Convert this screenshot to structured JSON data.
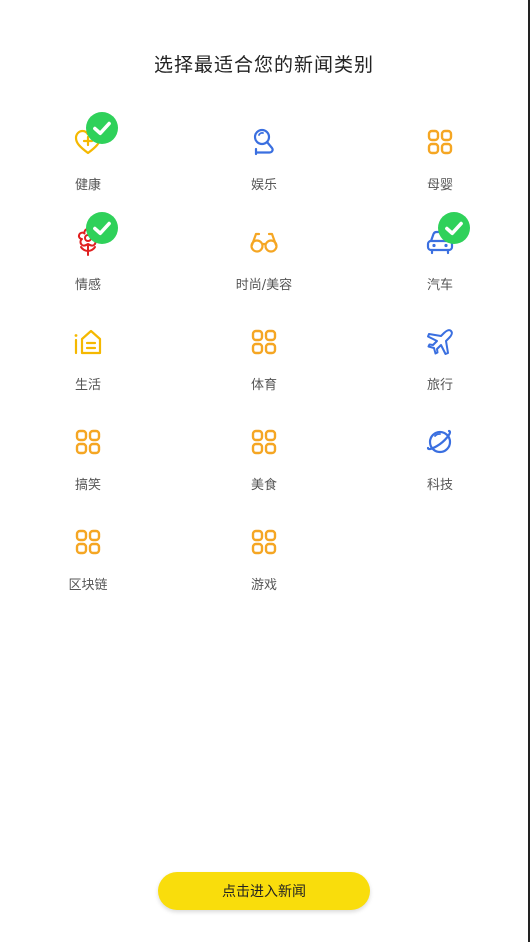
{
  "title": "选择最适合您的新闻类别",
  "categories": [
    {
      "label": "健康",
      "icon": "heart-plus-icon",
      "selected": true,
      "color": "#f5b800"
    },
    {
      "label": "娱乐",
      "icon": "magnifier-icon",
      "selected": false,
      "color": "#3a6fe0"
    },
    {
      "label": "母婴",
      "icon": "grid-icon",
      "selected": false,
      "color": "#f5a623"
    },
    {
      "label": "情感",
      "icon": "flower-icon",
      "selected": true,
      "color": "#e02020"
    },
    {
      "label": "时尚/美容",
      "icon": "glasses-icon",
      "selected": false,
      "color": "#f5a623"
    },
    {
      "label": "汽车",
      "icon": "car-icon",
      "selected": true,
      "color": "#3a6fe0"
    },
    {
      "label": "生活",
      "icon": "house-icon",
      "selected": false,
      "color": "#f5b800"
    },
    {
      "label": "体育",
      "icon": "grid-icon",
      "selected": false,
      "color": "#f5a623"
    },
    {
      "label": "旅行",
      "icon": "airplane-icon",
      "selected": false,
      "color": "#3a6fe0"
    },
    {
      "label": "搞笑",
      "icon": "grid-icon",
      "selected": false,
      "color": "#f5a623"
    },
    {
      "label": "美食",
      "icon": "grid-icon",
      "selected": false,
      "color": "#f5a623"
    },
    {
      "label": "科技",
      "icon": "planet-icon",
      "selected": false,
      "color": "#3a6fe0"
    },
    {
      "label": "区块链",
      "icon": "grid-icon",
      "selected": false,
      "color": "#f5a623"
    },
    {
      "label": "游戏",
      "icon": "grid-icon",
      "selected": false,
      "color": "#f5a623"
    }
  ],
  "check_color": "#2fd15a",
  "enter_button": {
    "label": "点击进入新闻",
    "color": "#f9dd0c"
  }
}
